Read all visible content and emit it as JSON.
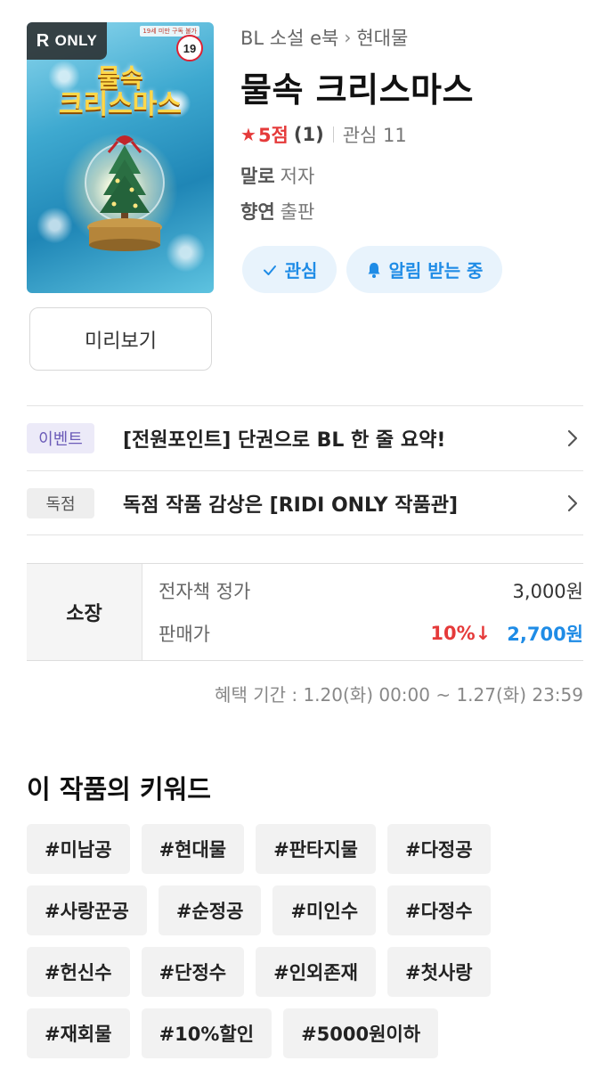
{
  "cover": {
    "badge": "ONLY",
    "badge_mark": "R",
    "age_rating": "19",
    "age_warning": "19세 미만 구독 불가",
    "title_line1": "물속",
    "title_line2": "크리스마스"
  },
  "preview_label": "미리보기",
  "breadcrumb": {
    "category": "BL 소설 e북",
    "separator": "›",
    "subcategory": "현대물"
  },
  "book": {
    "title": "물속 크리스마스",
    "rating_score": "5점",
    "rating_count": "(1)",
    "interest": "관심 11",
    "author_name": "말로",
    "author_suffix": "저자",
    "publisher_name": "향연",
    "publisher_suffix": "출판"
  },
  "actions": {
    "interest_label": "관심",
    "alarm_label": "알림 받는 중"
  },
  "notices": [
    {
      "tag": "이벤트",
      "text": "[전원포인트] 단권으로 BL 한 줄 요약!"
    },
    {
      "tag": "독점",
      "text": "독점 작품 감상은 [RIDI ONLY 작품관]"
    }
  ],
  "price": {
    "label": "소장",
    "list_label": "전자책 정가",
    "list_value": "3,000원",
    "sale_label": "판매가",
    "discount": "10%↓",
    "sale_value": "2,700원",
    "benefit_period": "혜택 기간 : 1.20(화) 00:00 ~ 1.27(화) 23:59"
  },
  "keywords_title": "이 작품의 키워드",
  "keywords": [
    "#미남공",
    "#현대물",
    "#판타지물",
    "#다정공",
    "#사랑꾼공",
    "#순정공",
    "#미인수",
    "#다정수",
    "#헌신수",
    "#단정수",
    "#인외존재",
    "#첫사랑",
    "#재회물",
    "#10%할인",
    "#5000원이하"
  ],
  "colors": {
    "accent_blue": "#1f8ce6",
    "accent_red": "#e53a3a",
    "chip_bg": "#e8f3fc"
  }
}
